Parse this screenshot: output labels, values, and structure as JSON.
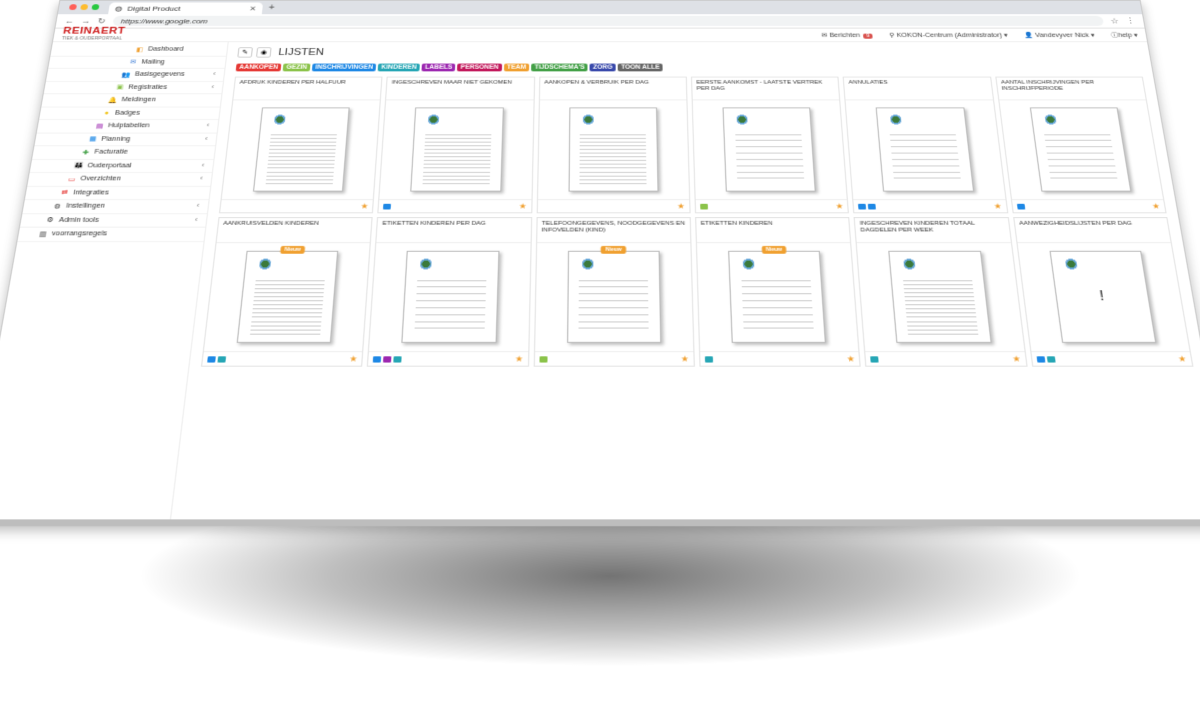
{
  "browser": {
    "tab_title": "Digital Product",
    "url": "https://www.google.com"
  },
  "app": {
    "logo": "REINAERT",
    "logo_sub": "TIEK & OUDERPORTAAL",
    "header": {
      "messages_label": "Berichten",
      "messages_count": "9",
      "location": "KOKON-Centrum (Administrator)",
      "user": "Vandevyver Nick",
      "help": "help"
    }
  },
  "sidebar": {
    "items": [
      {
        "label": "Dashboard",
        "icon": "dashboard-icon",
        "color": "#f0a030",
        "has_chevron": false
      },
      {
        "label": "Mailing",
        "icon": "mail-icon",
        "color": "#3a7bd5",
        "has_chevron": false
      },
      {
        "label": "Basisgegevens",
        "icon": "users-icon",
        "color": "#3a7bd5",
        "has_chevron": true
      },
      {
        "label": "Registraties",
        "icon": "register-icon",
        "color": "#8bc34a",
        "has_chevron": true
      },
      {
        "label": "Meldingen",
        "icon": "bell-icon",
        "color": "#e53935",
        "has_chevron": false
      },
      {
        "label": "Badges",
        "icon": "badge-icon",
        "color": "#f0c419",
        "has_chevron": false
      },
      {
        "label": "Hulptabellen",
        "icon": "table-icon",
        "color": "#9c27b0",
        "has_chevron": true
      },
      {
        "label": "Planning",
        "icon": "calendar-icon",
        "color": "#1e88e5",
        "has_chevron": true
      },
      {
        "label": "Facturatie",
        "icon": "money-icon",
        "color": "#43a047",
        "has_chevron": false
      },
      {
        "label": "Ouderportaal",
        "icon": "parents-icon",
        "color": "#e53935",
        "has_chevron": true
      },
      {
        "label": "Overzichten",
        "icon": "monitor-icon",
        "color": "#e53935",
        "has_chevron": true
      },
      {
        "label": "Integraties",
        "icon": "sync-icon",
        "color": "#e53935",
        "has_chevron": false
      },
      {
        "label": "Instellingen",
        "icon": "gears-icon",
        "color": "#333333",
        "has_chevron": true
      },
      {
        "label": "Admin tools",
        "icon": "tools-icon",
        "color": "#333333",
        "has_chevron": true
      },
      {
        "label": "voorrangsregels",
        "icon": "book-icon",
        "color": "#333333",
        "has_chevron": false
      }
    ]
  },
  "page": {
    "title": "LIJSTEN",
    "filters": [
      {
        "label": "AANKOPEN",
        "color": "#e53935"
      },
      {
        "label": "GEZIN",
        "color": "#8bc34a"
      },
      {
        "label": "INSCHRIJVINGEN",
        "color": "#1e88e5"
      },
      {
        "label": "KINDEREN",
        "color": "#26a6b5"
      },
      {
        "label": "LABELS",
        "color": "#9c27b0"
      },
      {
        "label": "PERSONEN",
        "color": "#c2185b"
      },
      {
        "label": "TEAM",
        "color": "#f0a030"
      },
      {
        "label": "TIJDSCHEMA'S",
        "color": "#43a047"
      },
      {
        "label": "ZORG",
        "color": "#3949ab"
      },
      {
        "label": "TOON ALLE",
        "color": "#666666"
      }
    ],
    "cards": [
      {
        "title": "AFDRUK KINDEREN PER HALFUUR",
        "nieuw": false,
        "tags": [],
        "doc": "table"
      },
      {
        "title": "INGESCHREVEN MAAR NIET GEKOMEN",
        "nieuw": false,
        "tags": [
          "#1e88e5"
        ],
        "doc": "table"
      },
      {
        "title": "AANKOPEN & VERBRUIK PER DAG",
        "nieuw": false,
        "tags": [],
        "doc": "table"
      },
      {
        "title": "EERSTE AANKOMST - LAATSTE VERTREK PER DAG",
        "nieuw": false,
        "tags": [
          "#8bc34a"
        ],
        "doc": "list"
      },
      {
        "title": "ANNULATIES",
        "nieuw": false,
        "tags": [
          "#1e88e5",
          "#1e88e5"
        ],
        "doc": "list"
      },
      {
        "title": "AANTAL INSCHRIJVINGEN PER INSCHRIJFPERIODE",
        "nieuw": false,
        "tags": [
          "#1e88e5"
        ],
        "doc": "list"
      },
      {
        "title": "AANKRUISVELDEN KINDEREN",
        "nieuw": true,
        "tags": [
          "#1e88e5",
          "#26a6b5"
        ],
        "doc": "table"
      },
      {
        "title": "ETIKETTEN KINDEREN PER DAG",
        "nieuw": false,
        "tags": [
          "#1e88e5",
          "#9c27b0",
          "#26a6b5"
        ],
        "doc": "list"
      },
      {
        "title": "TELEFOONGEGEVENS, NOODGEGEVENS EN INFOVELDEN (KIND)",
        "nieuw": true,
        "tags": [
          "#8bc34a"
        ],
        "doc": "list"
      },
      {
        "title": "ETIKETTEN KINDEREN",
        "nieuw": true,
        "tags": [
          "#26a6b5"
        ],
        "doc": "list"
      },
      {
        "title": "INGESCHREVEN KINDEREN TOTAAL DAGDELEN PER WEEK",
        "nieuw": false,
        "tags": [
          "#26a6b5"
        ],
        "doc": "table"
      },
      {
        "title": "AANWEZIGHEIDSLIJSTEN PER DAG",
        "nieuw": false,
        "tags": [
          "#1e88e5",
          "#26a6b5"
        ],
        "doc": "bang"
      }
    ],
    "nieuw_label": "Nieuw",
    "bang": "!"
  }
}
